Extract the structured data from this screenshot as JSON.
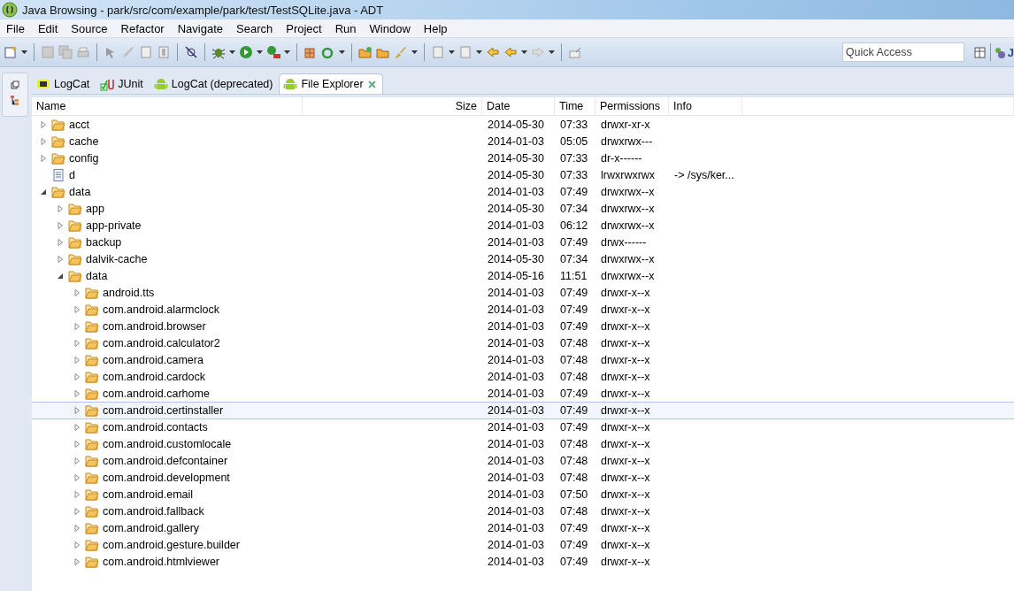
{
  "window": {
    "title": "Java Browsing - park/src/com/example/park/test/TestSQLite.java - ADT"
  },
  "menu": [
    "File",
    "Edit",
    "Source",
    "Refactor",
    "Navigate",
    "Search",
    "Project",
    "Run",
    "Window",
    "Help"
  ],
  "quick_access": {
    "placeholder": "Quick Access"
  },
  "perspective_label": "J",
  "tabs": [
    {
      "label": "LogCat",
      "selected": false,
      "kind": "logcat"
    },
    {
      "label": "JUnit",
      "selected": false,
      "kind": "junit"
    },
    {
      "label": "LogCat (deprecated)",
      "selected": false,
      "kind": "android"
    },
    {
      "label": "File Explorer",
      "selected": true,
      "kind": "android"
    }
  ],
  "table": {
    "columns": [
      "Name",
      "Size",
      "Date",
      "Time",
      "Permissions",
      "Info"
    ],
    "rows": [
      {
        "name": "acct",
        "kind": "folder",
        "expanded": false,
        "selected": false,
        "date": "2014-05-30",
        "time": "07:33",
        "permissions": "drwxr-xr-x"
      },
      {
        "name": "cache",
        "kind": "folder",
        "expanded": false,
        "selected": false,
        "date": "2014-01-03",
        "time": "05:05",
        "permissions": "drwxrwx---"
      },
      {
        "name": "config",
        "kind": "folder",
        "expanded": false,
        "selected": false,
        "date": "2014-05-30",
        "time": "07:33",
        "permissions": "dr-x------"
      },
      {
        "name": "d",
        "kind": "file",
        "selected": false,
        "date": "2014-05-30",
        "time": "07:33",
        "permissions": "lrwxrwxrwx",
        "info": "-> /sys/ker..."
      },
      {
        "name": "data",
        "kind": "folder",
        "expanded": true,
        "selected": false,
        "date": "2014-01-03",
        "time": "07:49",
        "permissions": "drwxrwx--x",
        "children": [
          {
            "name": "app",
            "kind": "folder",
            "expanded": false,
            "selected": false,
            "date": "2014-05-30",
            "time": "07:34",
            "permissions": "drwxrwx--x"
          },
          {
            "name": "app-private",
            "kind": "folder",
            "expanded": false,
            "selected": false,
            "date": "2014-01-03",
            "time": "06:12",
            "permissions": "drwxrwx--x"
          },
          {
            "name": "backup",
            "kind": "folder",
            "expanded": false,
            "selected": false,
            "date": "2014-01-03",
            "time": "07:49",
            "permissions": "drwx------"
          },
          {
            "name": "dalvik-cache",
            "kind": "folder",
            "expanded": false,
            "selected": false,
            "date": "2014-05-30",
            "time": "07:34",
            "permissions": "drwxrwx--x"
          },
          {
            "name": "data",
            "kind": "folder",
            "expanded": true,
            "selected": false,
            "date": "2014-05-16",
            "time": "11:51",
            "permissions": "drwxrwx--x",
            "children": [
              {
                "name": "android.tts",
                "kind": "folder",
                "expanded": false,
                "selected": false,
                "date": "2014-01-03",
                "time": "07:49",
                "permissions": "drwxr-x--x"
              },
              {
                "name": "com.android.alarmclock",
                "kind": "folder",
                "expanded": false,
                "selected": false,
                "date": "2014-01-03",
                "time": "07:49",
                "permissions": "drwxr-x--x"
              },
              {
                "name": "com.android.browser",
                "kind": "folder",
                "expanded": false,
                "selected": false,
                "date": "2014-01-03",
                "time": "07:49",
                "permissions": "drwxr-x--x"
              },
              {
                "name": "com.android.calculator2",
                "kind": "folder",
                "expanded": false,
                "selected": false,
                "date": "2014-01-03",
                "time": "07:48",
                "permissions": "drwxr-x--x"
              },
              {
                "name": "com.android.camera",
                "kind": "folder",
                "expanded": false,
                "selected": false,
                "date": "2014-01-03",
                "time": "07:48",
                "permissions": "drwxr-x--x"
              },
              {
                "name": "com.android.cardock",
                "kind": "folder",
                "expanded": false,
                "selected": false,
                "date": "2014-01-03",
                "time": "07:48",
                "permissions": "drwxr-x--x"
              },
              {
                "name": "com.android.carhome",
                "kind": "folder",
                "expanded": false,
                "selected": false,
                "date": "2014-01-03",
                "time": "07:49",
                "permissions": "drwxr-x--x"
              },
              {
                "name": "com.android.certinstaller",
                "kind": "folder",
                "expanded": false,
                "selected": true,
                "date": "2014-01-03",
                "time": "07:49",
                "permissions": "drwxr-x--x"
              },
              {
                "name": "com.android.contacts",
                "kind": "folder",
                "expanded": false,
                "selected": false,
                "date": "2014-01-03",
                "time": "07:49",
                "permissions": "drwxr-x--x"
              },
              {
                "name": "com.android.customlocale",
                "kind": "folder",
                "expanded": false,
                "selected": false,
                "date": "2014-01-03",
                "time": "07:48",
                "permissions": "drwxr-x--x"
              },
              {
                "name": "com.android.defcontainer",
                "kind": "folder",
                "expanded": false,
                "selected": false,
                "date": "2014-01-03",
                "time": "07:48",
                "permissions": "drwxr-x--x"
              },
              {
                "name": "com.android.development",
                "kind": "folder",
                "expanded": false,
                "selected": false,
                "date": "2014-01-03",
                "time": "07:48",
                "permissions": "drwxr-x--x"
              },
              {
                "name": "com.android.email",
                "kind": "folder",
                "expanded": false,
                "selected": false,
                "date": "2014-01-03",
                "time": "07:50",
                "permissions": "drwxr-x--x"
              },
              {
                "name": "com.android.fallback",
                "kind": "folder",
                "expanded": false,
                "selected": false,
                "date": "2014-01-03",
                "time": "07:48",
                "permissions": "drwxr-x--x"
              },
              {
                "name": "com.android.gallery",
                "kind": "folder",
                "expanded": false,
                "selected": false,
                "date": "2014-01-03",
                "time": "07:49",
                "permissions": "drwxr-x--x"
              },
              {
                "name": "com.android.gesture.builder",
                "kind": "folder",
                "expanded": false,
                "selected": false,
                "date": "2014-01-03",
                "time": "07:49",
                "permissions": "drwxr-x--x"
              },
              {
                "name": "com.android.htmlviewer",
                "kind": "folder",
                "expanded": false,
                "selected": false,
                "date": "2014-01-03",
                "time": "07:49",
                "permissions": "drwxr-x--x"
              }
            ]
          }
        ]
      }
    ]
  }
}
